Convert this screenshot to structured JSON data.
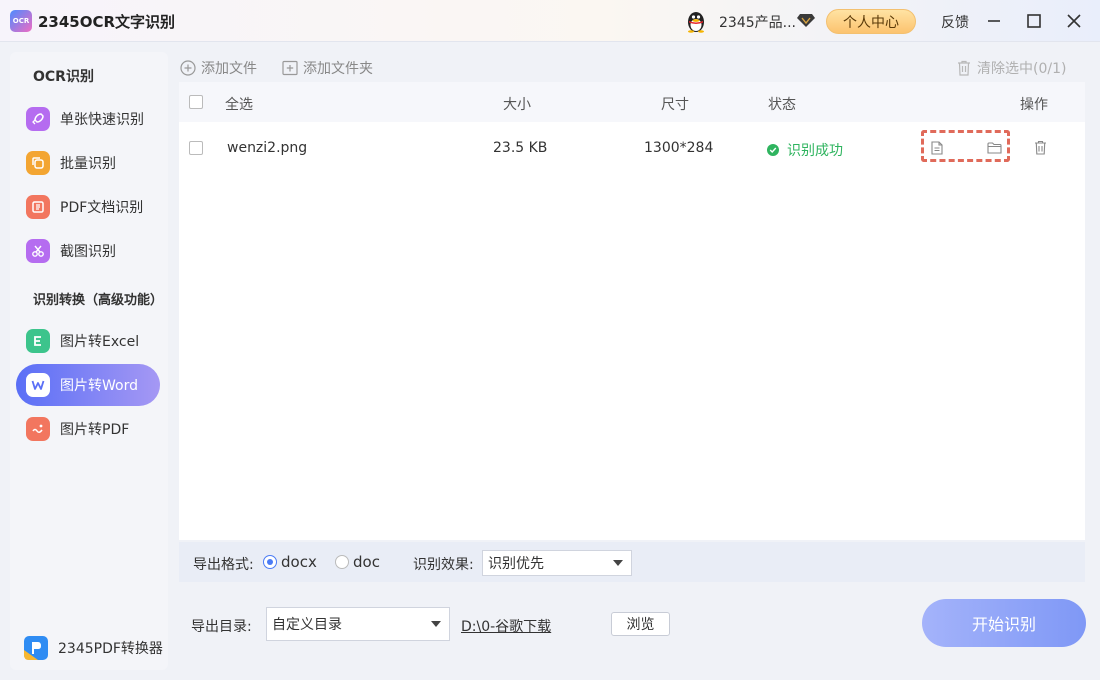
{
  "app": {
    "title": "2345OCR文字识别",
    "logo_text": "OCR"
  },
  "titlebar": {
    "user_name": "2345产品...",
    "personal_center": "个人中心",
    "feedback": "反馈"
  },
  "sidebar": {
    "section1_title": "OCR识别",
    "section2_title": "识别转换（高级功能）",
    "items": [
      {
        "label": "单张快速识别",
        "icon": "rocket-icon",
        "color": "#b56cf0"
      },
      {
        "label": "批量识别",
        "icon": "batch-icon",
        "color": "#f3a532"
      },
      {
        "label": "PDF文档识别",
        "icon": "pdf-doc-icon",
        "color": "#f2765f"
      },
      {
        "label": "截图识别",
        "icon": "scissors-icon",
        "color": "#b56cf0"
      },
      {
        "label": "图片转Excel",
        "icon": "excel-icon",
        "color": "#3cc48c"
      },
      {
        "label": "图片转Word",
        "icon": "word-icon",
        "color": "#5a6ff6"
      },
      {
        "label": "图片转PDF",
        "icon": "pdf-icon",
        "color": "#f2765f"
      }
    ],
    "active_index": 5,
    "bottom_app": "2345PDF转换器"
  },
  "toolbar": {
    "add_file": "添加文件",
    "add_folder": "添加文件夹",
    "clear_selected": "清除选中(0/1)"
  },
  "table": {
    "headers": {
      "select_all": "全选",
      "size": "大小",
      "dimensions": "尺寸",
      "status": "状态",
      "actions": "操作"
    },
    "rows": [
      {
        "name": "wenzi2.png",
        "size": "23.5 KB",
        "dimensions": "1300*284",
        "status": "识别成功"
      }
    ]
  },
  "options": {
    "format_label": "导出格式:",
    "formats": [
      "docx",
      "doc"
    ],
    "selected_format": "docx",
    "effect_label": "识别效果:",
    "effect_value": "识别优先",
    "dir_label": "导出目录:",
    "dir_select": "自定义目录",
    "dir_path": "D:\\0-谷歌下载",
    "browse": "浏览",
    "start": "开始识别"
  }
}
